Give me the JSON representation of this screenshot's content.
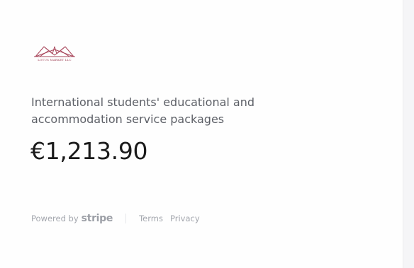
{
  "merchant": {
    "logo_text": "LOTUS MARKET LLC",
    "logo_icon": "lotus-logo-icon",
    "brand_color": "#9b3a4f"
  },
  "product": {
    "name": "International students' educational and accommodation service packages",
    "price": "€1,213.90"
  },
  "footer": {
    "powered_by": "Powered by",
    "stripe": "stripe",
    "terms": "Terms",
    "privacy": "Privacy"
  }
}
